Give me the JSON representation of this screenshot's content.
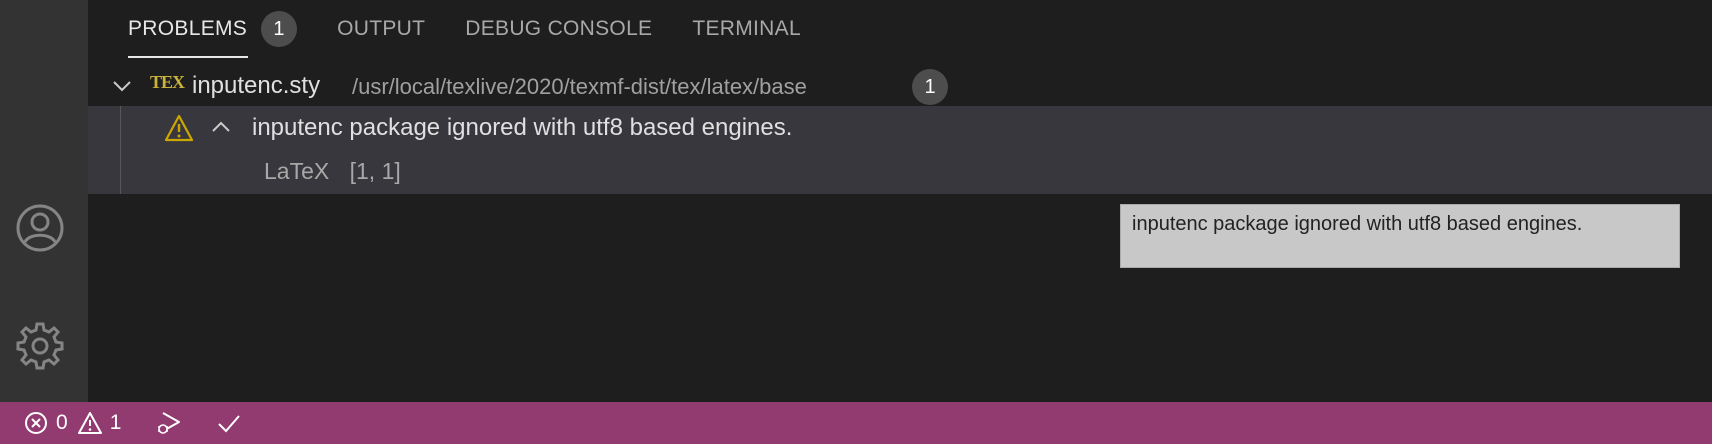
{
  "tabs": [
    {
      "label": "PROBLEMS",
      "badge": "1",
      "active": true
    },
    {
      "label": "OUTPUT"
    },
    {
      "label": "DEBUG CONSOLE"
    },
    {
      "label": "TERMINAL"
    }
  ],
  "file": {
    "icon": "tex-icon",
    "icon_text": "TEX",
    "name": "inputenc.sty",
    "path": "/usr/local/texlive/2020/texmf-dist/tex/latex/base",
    "count": "1"
  },
  "problem": {
    "severity": "warning",
    "message": "inputenc package ignored with utf8 based engines.",
    "source": "LaTeX",
    "position": "[1, 1]"
  },
  "tooltip": {
    "text": "inputenc package ignored with utf8 based engines."
  },
  "activity_bar": {
    "icons": [
      "account-icon",
      "settings-gear-icon"
    ]
  },
  "status_bar": {
    "errors": "0",
    "warnings": "1",
    "icons": [
      "error-icon",
      "warning-icon",
      "debug-run-icon",
      "check-icon"
    ]
  },
  "colors": {
    "status_bar": "#923b70",
    "panel_bg": "#1e1e1e",
    "activity_bar": "#333333",
    "selected_row": "#37373d",
    "tex_icon": "#c9b33a",
    "warning": "#cca700"
  }
}
